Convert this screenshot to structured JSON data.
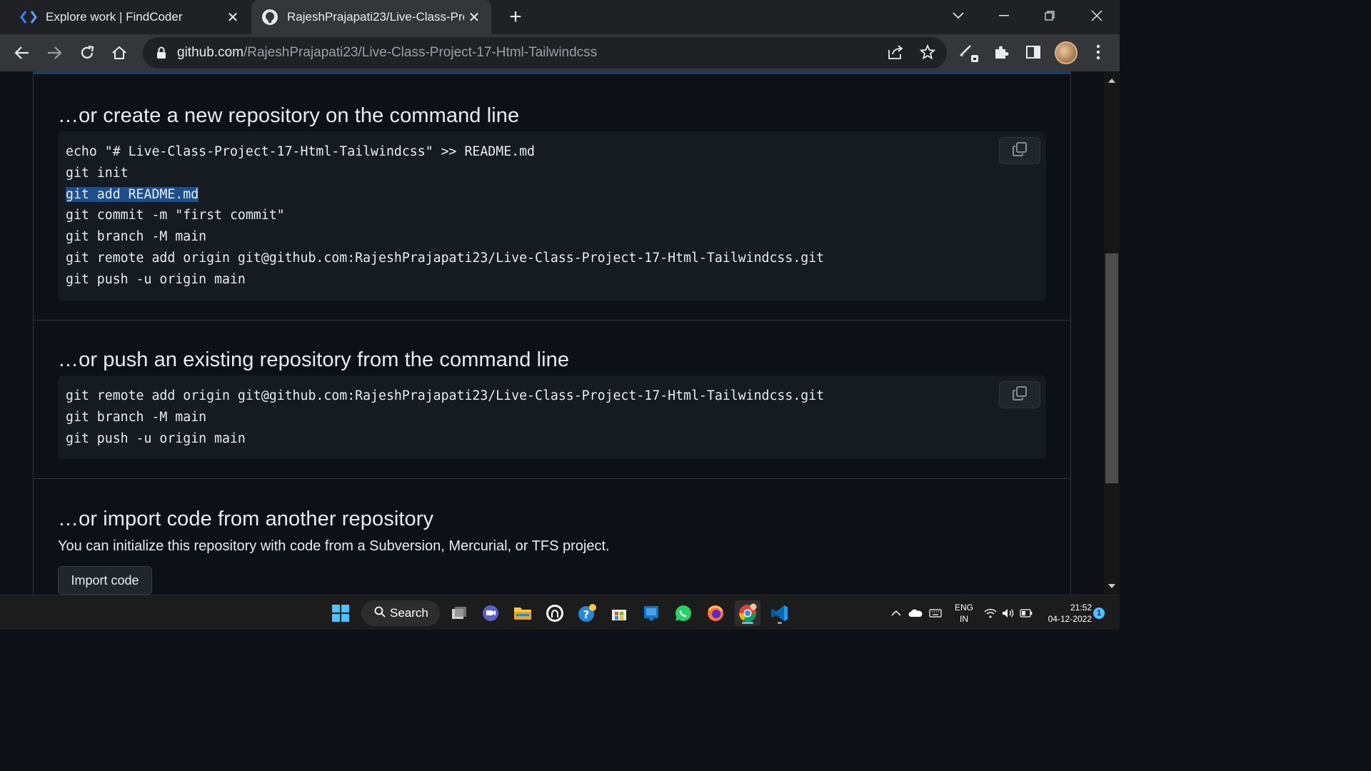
{
  "browser": {
    "tabs": [
      {
        "title": "Explore work | FindCoder",
        "active": false
      },
      {
        "title": "RajeshPrajapati23/Live-Class-Proj",
        "active": true
      }
    ],
    "url_host": "github.com",
    "url_path": "/RajeshPrajapati23/Live-Class-Project-17-Html-Tailwindcss"
  },
  "sections": {
    "create": {
      "heading": "…or create a new repository on the command line",
      "lines": [
        "echo \"# Live-Class-Project-17-Html-Tailwindcss\" >> README.md",
        "git init",
        "git add README.md",
        "git commit -m \"first commit\"",
        "git branch -M main",
        "git remote add origin git@github.com:RajeshPrajapati23/Live-Class-Project-17-Html-Tailwindcss.git",
        "git push -u origin main"
      ],
      "selected_line": "git add README.md"
    },
    "push": {
      "heading": "…or push an existing repository from the command line",
      "lines": [
        "git remote add origin git@github.com:RajeshPrajapati23/Live-Class-Project-17-Html-Tailwindcss.git",
        "git branch -M main",
        "git push -u origin main"
      ]
    },
    "import": {
      "heading": "…or import code from another repository",
      "description": "You can initialize this repository with code from a Subversion, Mercurial, or TFS project.",
      "button_label": "Import code"
    }
  },
  "taskbar": {
    "search_label": "Search",
    "language": "ENG",
    "region": "IN",
    "time": "21:52",
    "date": "04-12-2022",
    "notification_count": "1"
  },
  "colors": {
    "page_bg": "#0d1117",
    "code_bg": "#161b22",
    "selection": "#1f4f8a",
    "border": "#30363d"
  }
}
